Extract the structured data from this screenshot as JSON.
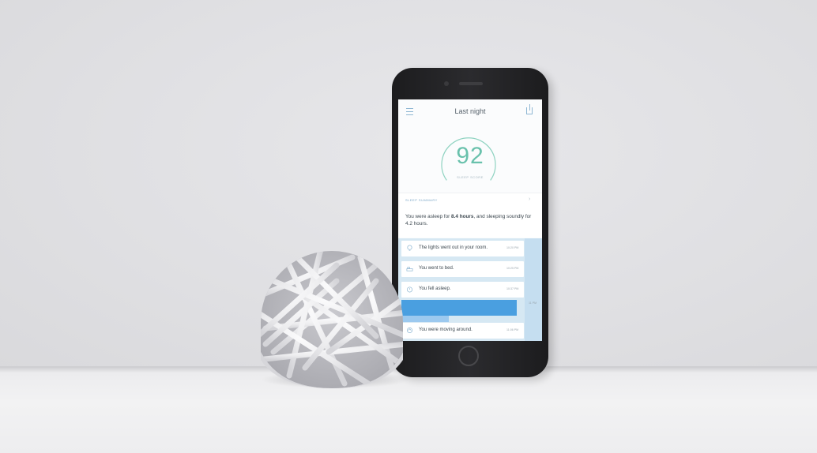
{
  "scene": "product photo",
  "phone_app": {
    "header": {
      "title": "Last night",
      "menu_icon": "hamburger-menu-icon",
      "share_icon": "share-icon"
    },
    "sleep_score": {
      "value": "92",
      "label": "SLEEP SCORE",
      "color": "#69c1ac"
    },
    "summary": {
      "title": "SLEEP SUMMARY",
      "text_prefix": "You were asleep for ",
      "text_bold": "8.4 hours",
      "text_suffix": ", and sleeping soundly for 4.2 hours."
    },
    "timeline": {
      "events": [
        {
          "icon": "lightbulb-icon",
          "text": "The lights went out in your room.",
          "time": "10:20 PM"
        },
        {
          "icon": "bed-icon",
          "text": "You went to bed.",
          "time": "10:25 PM"
        },
        {
          "icon": "moon-clock-icon",
          "text": "You fell asleep.",
          "time": "10:37 PM"
        },
        {
          "icon": "motion-icon",
          "text": "You were moving around.",
          "time": "11:06 PM"
        }
      ],
      "side_time": "11 PM",
      "bar_color": "#4a9fe0"
    }
  },
  "colors": {
    "accent_blue": "#8fb7d3",
    "wall": "#e3e3e6",
    "orb": "#f2f2f3"
  }
}
